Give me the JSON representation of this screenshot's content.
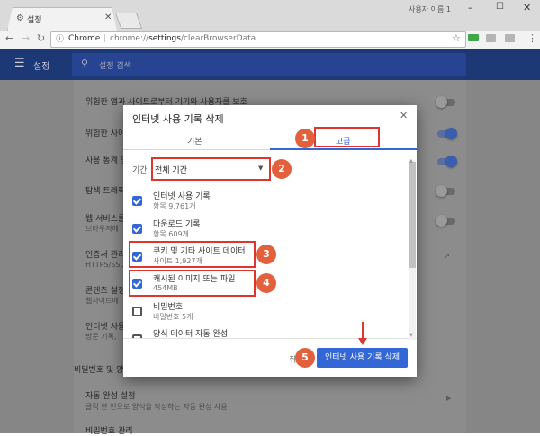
{
  "browser": {
    "tab_title": "설정",
    "window_user": "사용자 이름 1",
    "omnibox_scheme": "Chrome",
    "omnibox_url": "chrome://settings/clearBrowserData",
    "url_host": "chrome://",
    "url_path_bold": "settings",
    "url_rest": "/clearBrowserData"
  },
  "settings_header": {
    "title": "설정",
    "search_placeholder": "설정 검색"
  },
  "background_rows": [
    {
      "text": "위험한 앱과 사이트로부터 기기와 사용자를 보호",
      "toggle": "off"
    },
    {
      "text": "위험한 사이",
      "toggle": "on"
    },
    {
      "text": "사용 통계 및",
      "toggle": "on"
    },
    {
      "text": "탐색 트래픽",
      "toggle": "off"
    },
    {
      "text": "웹 서비스를",
      "sub": "브라우저에",
      "toggle": "off"
    },
    {
      "text": "인증서 관리",
      "sub": "HTTPS/SSL"
    },
    {
      "text": "콘텐츠 설정",
      "sub": "웹사이트에"
    },
    {
      "text": "인터넷 사용",
      "sub": "방문 기록,"
    }
  ],
  "section_passwords": "비밀번호 및 양식",
  "autofill_row": {
    "title": "자동 완성 설정",
    "sub": "클릭 한 번으로 양식을 작성하는 자동 완성 사용"
  },
  "password_row": {
    "title": "비밀번호 관리"
  },
  "dialog": {
    "title": "인터넷 사용 기록 삭제",
    "tab_basic": "기본",
    "tab_advanced": "고급",
    "period_label": "기간",
    "period_value": "전체 기간",
    "items": [
      {
        "title": "인터넷 사용 기록",
        "sub": "항목 9,761개",
        "checked": true
      },
      {
        "title": "다운로드 기록",
        "sub": "항목 609개",
        "checked": true
      },
      {
        "title": "쿠키 및 기타 사이트 데이터",
        "sub": "사이트 1,927개",
        "checked": true
      },
      {
        "title": "캐시된 이미지 또는 파일",
        "sub": "454MB",
        "checked": true
      },
      {
        "title": "비밀번호",
        "sub": "비밀번호 5개",
        "checked": false
      },
      {
        "title": "양식 데이터 자동 완성",
        "sub": "",
        "checked": false
      }
    ],
    "cancel_label": "취",
    "confirm_label": "인터넷 사용 기록 삭제"
  },
  "annotation_numbers": [
    "1",
    "2",
    "3",
    "4",
    "5"
  ],
  "colors": {
    "accent": "#3367d6",
    "badge": "#e2603c",
    "highlight_box": "#e0342f"
  }
}
